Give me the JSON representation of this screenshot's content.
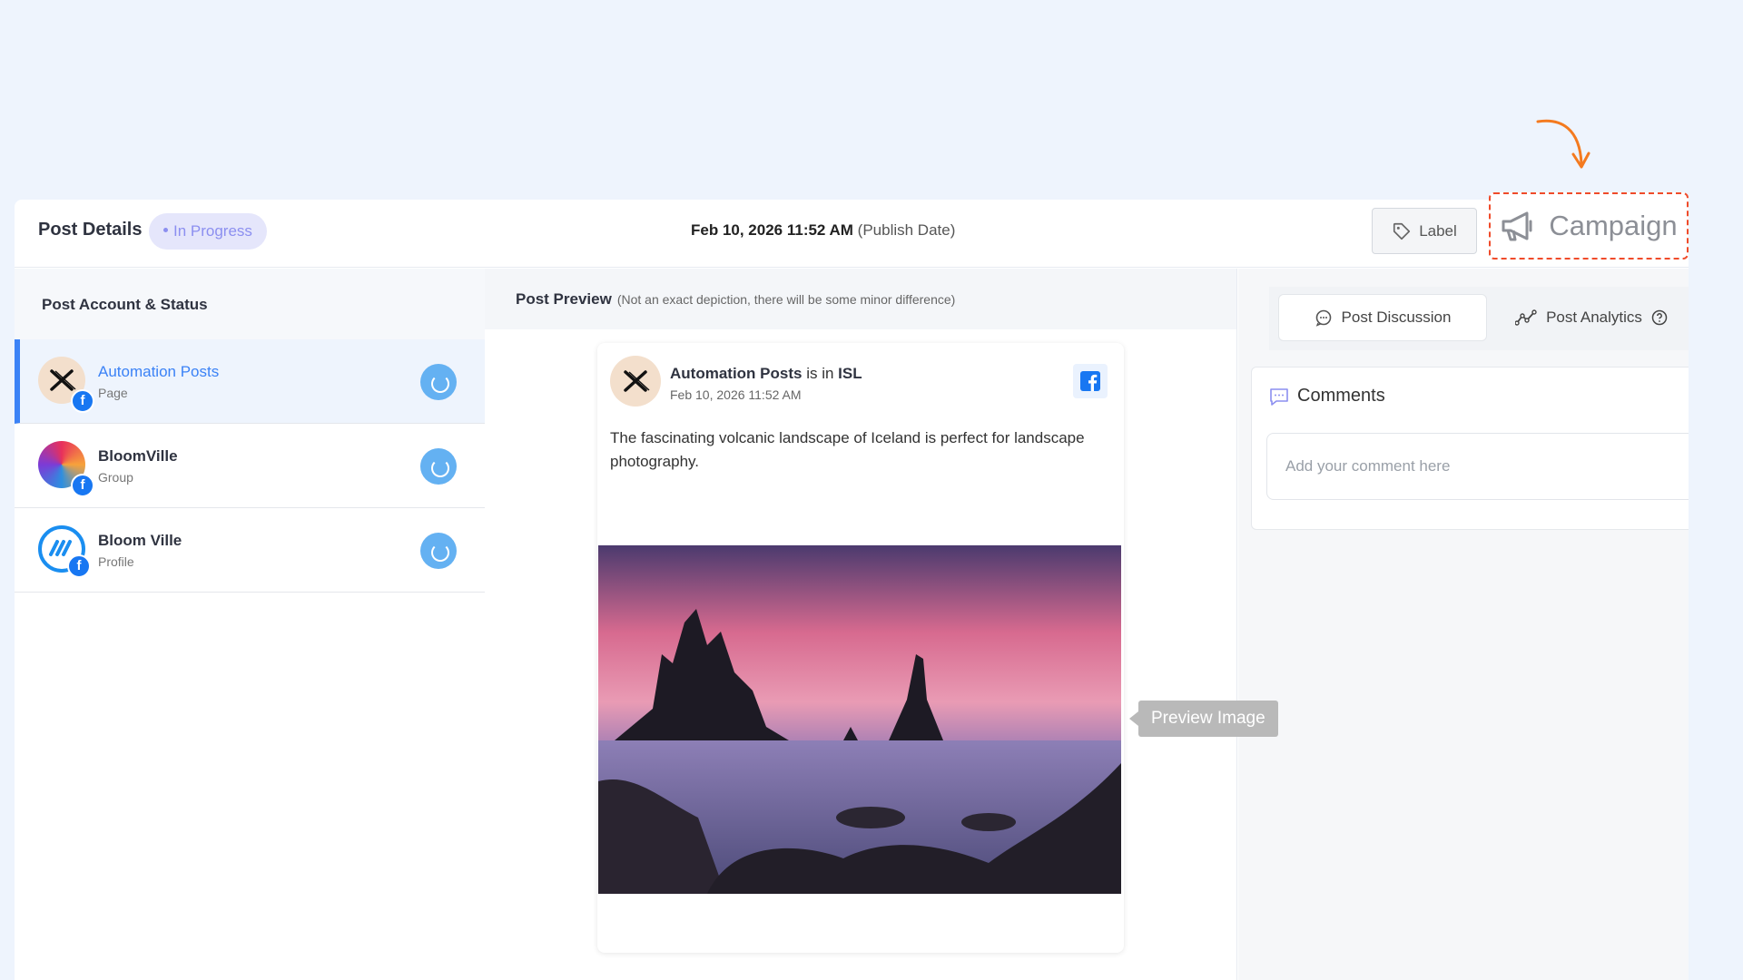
{
  "header": {
    "title": "Post Details",
    "status": "In Progress",
    "publish_date": "Feb 10, 2026 11:52 AM",
    "publish_suffix": "(Publish Date)",
    "label_button": "Label",
    "campaign_button": "Campaign"
  },
  "left": {
    "heading": "Post Account & Status",
    "accounts": [
      {
        "name": "Automation Posts",
        "type": "Page"
      },
      {
        "name": "BloomVille",
        "type": "Group"
      },
      {
        "name": "Bloom Ville",
        "type": "Profile"
      }
    ]
  },
  "preview": {
    "heading": "Post Preview",
    "note": "(Not an exact depiction, there will be some minor difference)",
    "card": {
      "account_name": "Automation Posts",
      "location_text": "is in",
      "location": "ISL",
      "date": "Feb 10, 2026 11:52 AM",
      "text": "The fascinating volcanic landscape of Iceland is perfect for landscape photography."
    },
    "tooltip": "Preview Image"
  },
  "right": {
    "tabs": [
      {
        "label": "Post Discussion"
      },
      {
        "label": "Post Analytics"
      }
    ],
    "comments_title": "Comments",
    "comment_placeholder": "Add your comment here"
  },
  "colors": {
    "accent": "#3b82f6",
    "status_bg": "#e5e6fb",
    "status_text": "#8c8ff0",
    "campaign_border": "#f04b2a",
    "arrow": "#f47a1f"
  }
}
